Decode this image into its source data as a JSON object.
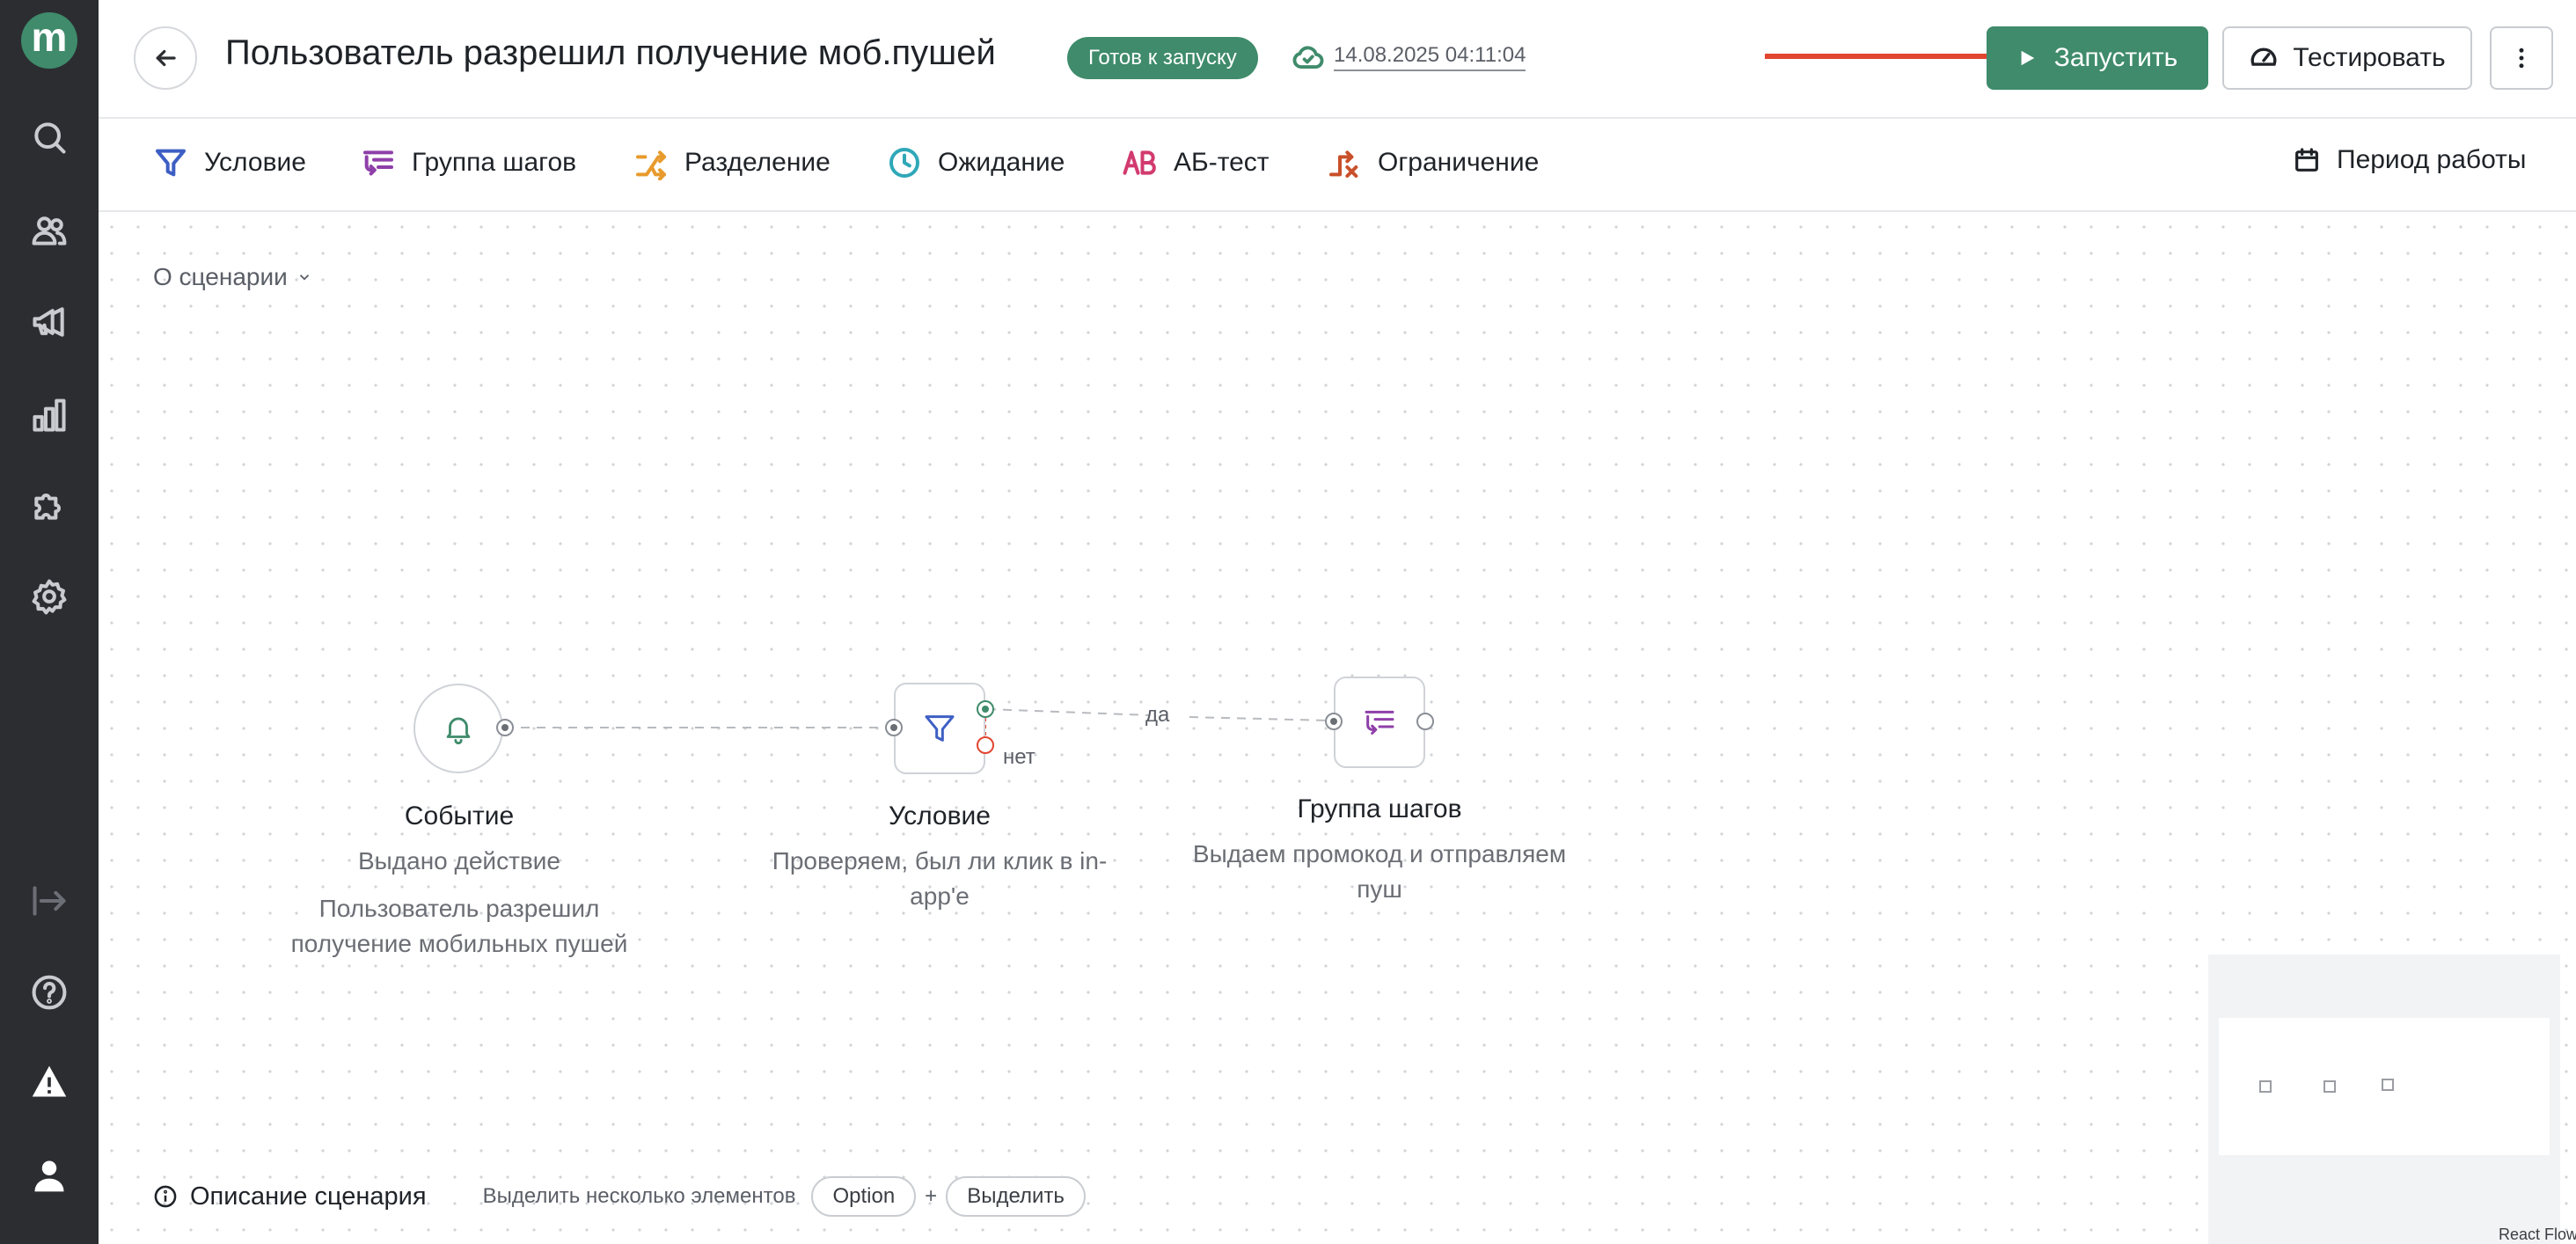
{
  "sidebar": {
    "logo": "m",
    "icons": [
      "search-icon",
      "users-icon",
      "megaphone-icon",
      "analytics-icon",
      "integrations-icon",
      "settings-icon",
      "collapse-icon",
      "help-icon",
      "warning-icon",
      "profile-icon"
    ]
  },
  "header": {
    "title": "Пользователь разрешил получение моб.пушей",
    "status": "Готов к запуску",
    "saved_at": "14.08.2025 04:11:04",
    "run_label": "Запустить",
    "test_label": "Тестировать"
  },
  "toolbar": {
    "items": [
      {
        "label": "Условие",
        "icon": "filter-icon"
      },
      {
        "label": "Группа шагов",
        "icon": "step-group-icon"
      },
      {
        "label": "Разделение",
        "icon": "split-icon"
      },
      {
        "label": "Ожидание",
        "icon": "clock-icon"
      },
      {
        "label": "АБ-тест",
        "icon": "ab-test-icon"
      },
      {
        "label": "Ограничение",
        "icon": "limit-icon"
      }
    ],
    "period_label": "Период работы"
  },
  "canvas": {
    "about_label": "О сценарии",
    "nodes": [
      {
        "title": "Событие",
        "subtitle": "Выдано действие",
        "description": "Пользователь разрешил получение мобильных пушей"
      },
      {
        "title": "Условие",
        "subtitle": "Проверяем, был ли клик в in-app'е"
      },
      {
        "title": "Группа шагов",
        "subtitle": "Выдаем промокод и отправляем пуш"
      }
    ],
    "edge_yes": "да",
    "edge_no": "нет",
    "react_flow": "React Flow"
  },
  "footer": {
    "description_label": "Описание сценария",
    "hint": "Выделить несколько элементов",
    "key_option": "Option",
    "plus": "+",
    "key_select": "Выделить"
  },
  "colors": {
    "brand": "#3f8b6b",
    "annotation_arrow": "#e2452f",
    "sidebar": "#2b2d31"
  }
}
